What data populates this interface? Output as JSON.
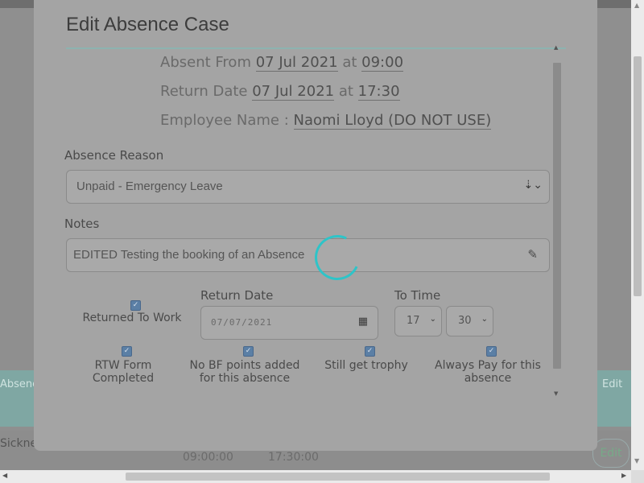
{
  "background": {
    "teal_left_text": "Absence",
    "teal_right_text": "Edit",
    "row_label": "Sickness",
    "row_start": "09:00:00",
    "row_end": "17:30:00",
    "row_button": "Edit"
  },
  "modal": {
    "title": "Edit Absence Case",
    "absent_from_label": "Absent From",
    "absent_from_date": "07 Jul 2021",
    "at_1": "at",
    "absent_from_time": "09:00",
    "return_date_label": "Return Date",
    "return_date": "07 Jul 2021",
    "at_2": "at",
    "return_time": "17:30",
    "employee_label": "Employee Name :",
    "employee_name": "Naomi Lloyd (DO NOT USE)",
    "absence_reason_label": "Absence Reason",
    "absence_reason_value": "Unpaid - Emergency Leave",
    "notes_label": "Notes",
    "notes_value": "EDITED Testing the booking of an Absence",
    "returned_to_work_label": "Returned To Work",
    "return_date_field_label": "Return Date",
    "return_date_field_value": "07/07/2021",
    "to_time_label": "To Time",
    "hour_value": "17",
    "minute_value": "30",
    "rtw_form_label_1": "RTW Form",
    "rtw_form_label_2": "Completed",
    "no_bf_label_1": "No BF points added",
    "no_bf_label_2": "for this absence",
    "trophy_label": "Still get trophy",
    "always_pay_label_1": "Always Pay for this",
    "always_pay_label_2": "absence"
  },
  "colors": {
    "accent": "#2ec4c8",
    "checkbox": "#5b7fa5",
    "overlay": "#9a9a9a"
  }
}
